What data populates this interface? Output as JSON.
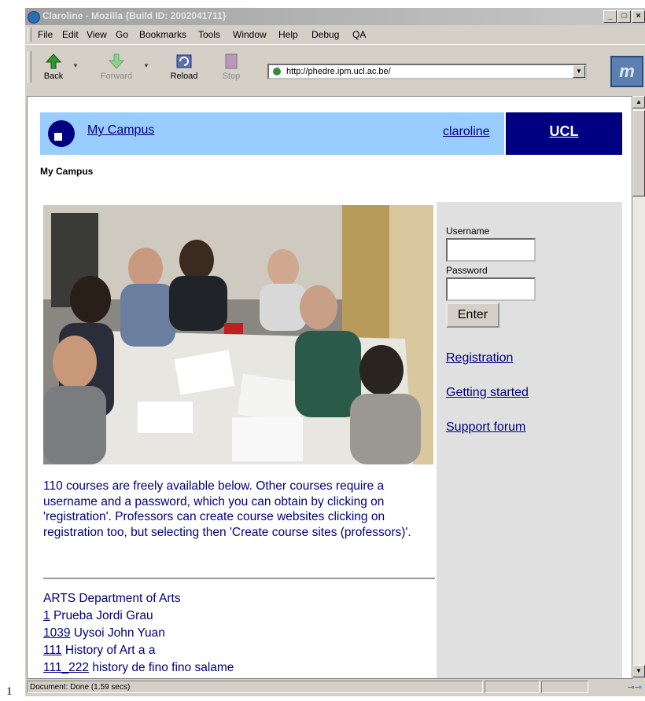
{
  "page_number": "1",
  "window": {
    "title": "Claroline - Mozilla {Build ID: 2002041711}",
    "controls": [
      "_",
      "□",
      "×"
    ]
  },
  "menu": [
    "File",
    "Edit",
    "View",
    "Go",
    "Bookmarks",
    "Tools",
    "Window",
    "Help",
    "Debug",
    "QA"
  ],
  "toolbar": {
    "back": "Back",
    "forward": "Forward",
    "reload": "Reload",
    "stop": "Stop",
    "url": "http://phedre.ipm.ucl.ac.be/",
    "brand": "m"
  },
  "header": {
    "campus_link": "My Campus",
    "user_link": "claroline",
    "ucl": "UCL",
    "breadcrumb": "My Campus"
  },
  "login": {
    "username_label": "Username",
    "password_label": "Password",
    "username_value": "",
    "password_value": "",
    "enter_button": "Enter"
  },
  "links": [
    "Registration",
    "Getting started",
    "Support forum"
  ],
  "intro": "110 courses are freely available below. Other courses require a username and a password, which you can obtain by clicking on 'registration'. Professors can create course websites clicking on registration too, but selecting then 'Create course sites (professors)'.",
  "department": "ARTS Department of Arts",
  "courses": [
    {
      "code": "1",
      "title": "Prueba Jordi Grau"
    },
    {
      "code": "1039",
      "title": "Uysoi John Yuan"
    },
    {
      "code": "111",
      "title": "History of Art a a"
    },
    {
      "code": "111_222",
      "title": "history de fino fino salame"
    }
  ],
  "status": "Document: Done (1.59 secs)"
}
